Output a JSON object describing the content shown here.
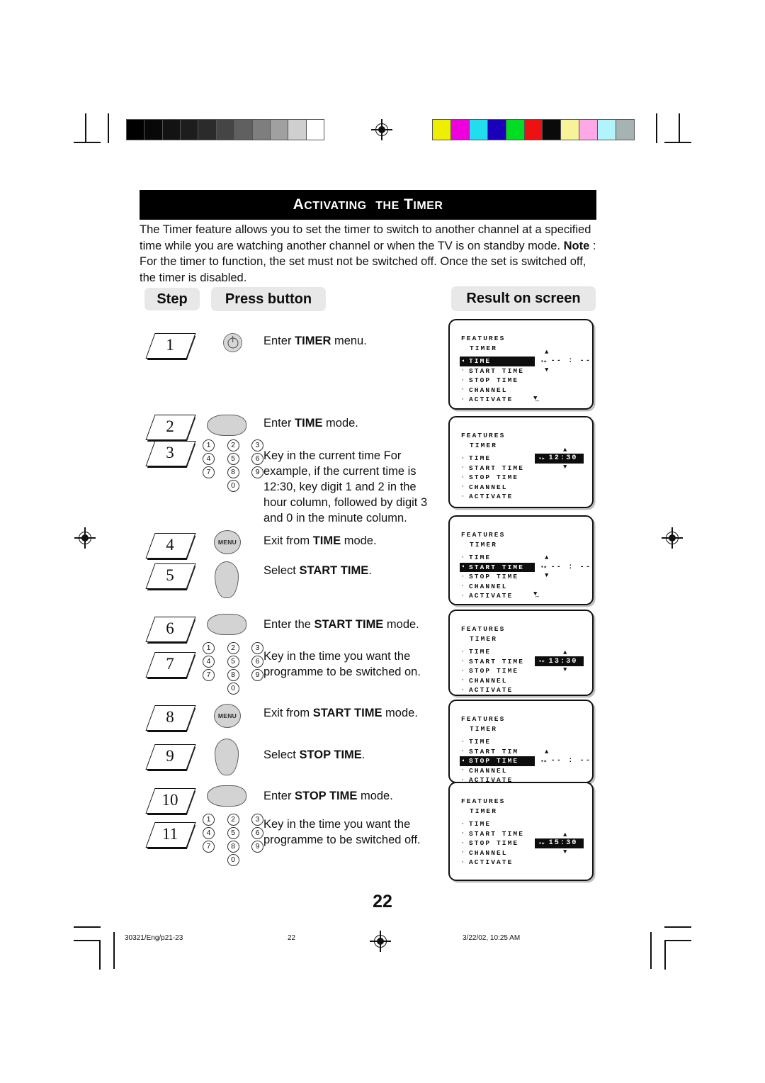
{
  "document": {
    "title_main": "ACTIVATING THE TIMER",
    "title_parts": {
      "a": "A",
      "ctivating": "CTIVATING",
      "the": "THE",
      "t": "T",
      "imer": "IMER"
    },
    "page_number": "22",
    "intro_line1": "The Timer feature allows you to set the timer to switch to another channel at a specified",
    "intro_line2": "time while you are watching another channel or when the TV is on standby mode.",
    "note_label": "Note",
    "note_text": " : For the timer to function, the set must not be switched off. Once the set is switched off, the timer is disabled."
  },
  "columns": {
    "step": "Step",
    "press_button": "Press button",
    "result_on_screen": "Result on screen"
  },
  "steps": [
    {
      "num": "1",
      "control": "power-button",
      "control_label": "",
      "text_before": "Enter ",
      "text_bold": "TIMER",
      "text_after": " menu."
    },
    {
      "num": "2",
      "control": "cursor-right",
      "control_label": "",
      "text_before": "Enter ",
      "text_bold": "TIME",
      "text_after": " mode."
    },
    {
      "num": "3",
      "control": "numeric-keypad",
      "control_label": "",
      "text_before": "Key in the  current time For example, if the current time is 12:30, key digit 1 and 2 in the hour column, followed by digit 3 and 0 in the minute column.",
      "text_bold": "",
      "text_after": ""
    },
    {
      "num": "4",
      "control": "menu-button",
      "control_label": "MENU",
      "text_before": "Exit from ",
      "text_bold": "TIME",
      "text_after": " mode."
    },
    {
      "num": "5",
      "control": "cursor-down",
      "control_label": "",
      "text_before": "Select ",
      "text_bold": "START TIME",
      "text_after": "."
    },
    {
      "num": "6",
      "control": "cursor-right",
      "control_label": "",
      "text_before": "Enter the ",
      "text_bold": "START TIME",
      "text_after": " mode."
    },
    {
      "num": "7",
      "control": "numeric-keypad",
      "control_label": "",
      "text_before": "Key in the time you want the programme to be switched on.",
      "text_bold": "",
      "text_after": ""
    },
    {
      "num": "8",
      "control": "menu-button",
      "control_label": "MENU",
      "text_before": "Exit from ",
      "text_bold": "START TIME",
      "text_after": " mode."
    },
    {
      "num": "9",
      "control": "cursor-down",
      "control_label": "",
      "text_before": "Select ",
      "text_bold": "STOP TIME",
      "text_after": "."
    },
    {
      "num": "10",
      "control": "cursor-right",
      "control_label": "",
      "text_before": "Enter ",
      "text_bold": "STOP TIME",
      "text_after": " mode."
    },
    {
      "num": "11",
      "control": "numeric-keypad",
      "control_label": "",
      "text_before": "Key in the time you want the programme to be switched off.",
      "text_bold": "",
      "text_after": ""
    }
  ],
  "keypad": {
    "keys": [
      "1",
      "2",
      "3",
      "4",
      "5",
      "6",
      "7",
      "8",
      "9"
    ],
    "zero": "0"
  },
  "screens": [
    {
      "header": "FEATURES",
      "sub": "TIMER",
      "items": [
        "TIME",
        "START TIME",
        "STOP TIME",
        "CHANNEL",
        "ACTIVATE"
      ],
      "selected_index": 0,
      "value": "-- : --",
      "value_inverted": false,
      "up_arrow": "▲",
      "down_arrow": "▼",
      "show_up": true,
      "show_down": true
    },
    {
      "header": "FEATURES",
      "sub": "TIMER",
      "items": [
        "TIME",
        "START TIME",
        "STOP TIME",
        "CHANNEL",
        "ACTIVATE"
      ],
      "selected_index": -1,
      "value": "12:30",
      "value_inverted": true,
      "up_arrow": "▲",
      "down_arrow": "▼",
      "show_up": true,
      "show_down": true
    },
    {
      "header": "FEATURES",
      "sub": "TIMER",
      "items": [
        "TIME",
        "START TIME",
        "STOP TIME",
        "CHANNEL",
        "ACTIVATE"
      ],
      "selected_index": 1,
      "value": "-- : --",
      "value_inverted": false,
      "up_arrow": "▲",
      "down_arrow": "▼",
      "show_up": true,
      "show_down": true
    },
    {
      "header": "FEATURES",
      "sub": "TIMER",
      "items": [
        "TIME",
        "START TIME",
        "STOP TIME",
        "CHANNEL",
        "ACTIVATE"
      ],
      "selected_index": -1,
      "value": "13:30",
      "value_inverted": true,
      "up_arrow": "▲",
      "down_arrow": "▼",
      "show_up": true,
      "show_down": true
    },
    {
      "header": "FEATURES",
      "sub": "TIMER",
      "items": [
        "TIME",
        "START TIM",
        "STOP TIME",
        "CHANNEL",
        "ACTIVATE"
      ],
      "selected_index": 2,
      "value": "-- : --",
      "value_inverted": false,
      "up_arrow": "▲",
      "down_arrow": "",
      "show_up": true,
      "show_down": false
    },
    {
      "header": "FEATURES",
      "sub": "TIMER",
      "items": [
        "TIME",
        "START TIME",
        "STOP TIME",
        "CHANNEL",
        "ACTIVATE"
      ],
      "selected_index": -1,
      "value": "15:30",
      "value_inverted": true,
      "up_arrow": "▲",
      "down_arrow": "▼",
      "show_up": true,
      "show_down": true
    }
  ],
  "footer": {
    "job_ref": "30321/Eng/p21-23",
    "page_ref": "22",
    "timestamp": "3/22/02, 10:25 AM"
  },
  "print_bars": {
    "grayscale": [
      "#000000",
      "#080808",
      "#131313",
      "#1d1d1d",
      "#2b2b2b",
      "#454545",
      "#606060",
      "#7e7e7e",
      "#a0a0a0",
      "#cfcfcf",
      "#ffffff"
    ],
    "colors": [
      "#eeee00",
      "#ee00dd",
      "#22ddee",
      "#1a00bb",
      "#00dd22",
      "#ee1111",
      "#0a0a0a",
      "#f7f39a",
      "#ffa8e8",
      "#b2f4fb",
      "#a6b3b3"
    ]
  }
}
